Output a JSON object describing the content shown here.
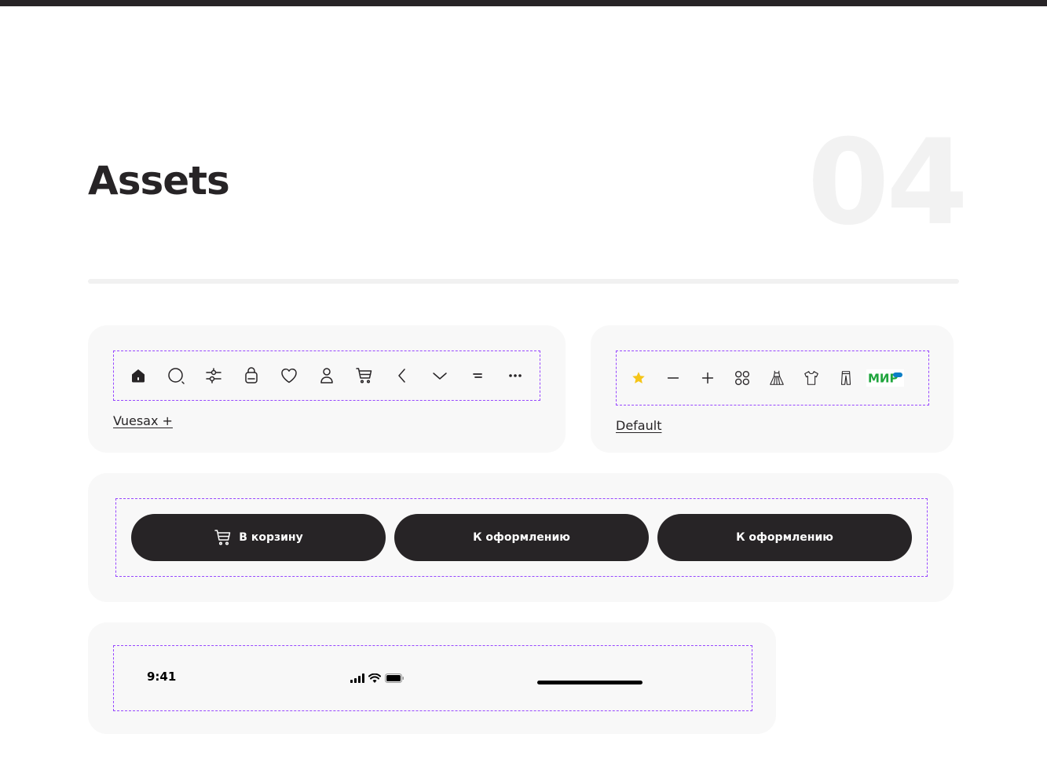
{
  "header": {
    "title": "Assets",
    "section_number": "04"
  },
  "icon_set_1": {
    "label": "Vuesax +",
    "icons": [
      "home-icon",
      "search-icon",
      "filter-icon",
      "bag-icon",
      "heart-icon",
      "profile-icon",
      "cart-icon",
      "chevron-left-icon",
      "chevron-down-icon",
      "menu-icon",
      "more-icon"
    ]
  },
  "icon_set_2": {
    "label": "Default",
    "icons": [
      "star-icon",
      "minus-icon",
      "plus-icon",
      "grid-icon",
      "dress-icon",
      "tshirt-icon",
      "pants-icon",
      "mir-logo"
    ],
    "mir_text": "МИР"
  },
  "buttons": {
    "cart_label": "В корзину",
    "checkout_label_1": "К оформлению",
    "checkout_label_2": "К оформлению"
  },
  "status_bar": {
    "time": "9:41"
  },
  "colors": {
    "dark": "#272426",
    "accent_frame": "#9747ff",
    "star": "#f5c518",
    "mir_green": "#1fa53d",
    "mir_blue": "#0c7ec6"
  }
}
